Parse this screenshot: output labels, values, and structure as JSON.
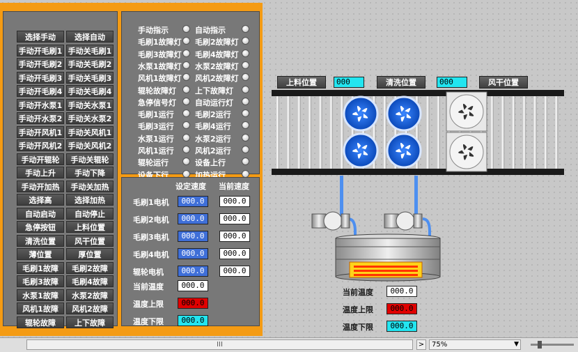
{
  "manual_buttons": [
    [
      "选择手动",
      "选择自动"
    ],
    [
      "手动开毛刷1",
      "手动关毛刷1"
    ],
    [
      "手动开毛刷2",
      "手动关毛刷2"
    ],
    [
      "手动开毛刷3",
      "手动关毛刷3"
    ],
    [
      "手动开毛刷4",
      "手动关毛刷4"
    ],
    [
      "手动开水泵1",
      "手动关水泵1"
    ],
    [
      "手动开水泵2",
      "手动关水泵2"
    ],
    [
      "手动开风机1",
      "手动关风机1"
    ],
    [
      "手动开风机2",
      "手动关风机2"
    ],
    [
      "手动开辊轮",
      "手动关辊轮"
    ],
    [
      "手动上升",
      "手动下降"
    ],
    [
      "手动开加热",
      "手动关加热"
    ],
    [
      "选择高",
      "选择加热"
    ],
    [
      "自动启动",
      "自动停止"
    ],
    [
      "急停按钮",
      "上料位置"
    ],
    [
      "清洗位置",
      "风干位置"
    ],
    [
      "薄位置",
      "厚位置"
    ],
    [
      "毛刷1故障",
      "毛刷2故障"
    ],
    [
      "毛刷3故障",
      "毛刷4故障"
    ],
    [
      "水泵1故障",
      "水泵2故障"
    ],
    [
      "风机1故障",
      "风机2故障"
    ],
    [
      "辊轮故障",
      "上下故障"
    ]
  ],
  "indicators": [
    [
      "手动指示",
      "自动指示"
    ],
    [
      "毛刷1故障灯",
      "毛刷2故障灯"
    ],
    [
      "毛刷3故障灯",
      "毛刷4故障灯"
    ],
    [
      "水泵1故障灯",
      "水泵2故障灯"
    ],
    [
      "风机1故障灯",
      "风机2故障灯"
    ],
    [
      "辊轮故障灯",
      "上下故障灯"
    ],
    [
      "急停信号灯",
      "自动运行灯"
    ],
    [
      "毛刷1运行",
      "毛刷2运行"
    ],
    [
      "毛刷3运行",
      "毛刷4运行"
    ],
    [
      "水泵1运行",
      "水泵2运行"
    ],
    [
      "风机1运行",
      "风机2运行"
    ],
    [
      "辊轮运行",
      "设备上行"
    ],
    [
      "设备下行",
      "加热运行"
    ]
  ],
  "speed": {
    "set_header": "设定速度",
    "cur_header": "当前速度",
    "rows": [
      {
        "label": "毛刷1电机",
        "set": "000.0",
        "cur": "000.0"
      },
      {
        "label": "毛刷2电机",
        "set": "000.0",
        "cur": "000.0"
      },
      {
        "label": "毛刷3电机",
        "set": "000.0",
        "cur": "000.0"
      },
      {
        "label": "毛刷4电机",
        "set": "000.0",
        "cur": "000.0"
      },
      {
        "label": "辊轮电机",
        "set": "000.0",
        "cur": "000.0"
      }
    ],
    "temp_rows": [
      {
        "label": "当前温度",
        "value": "000.0",
        "color": "#ffffff"
      },
      {
        "label": "温度上限",
        "value": "000.0",
        "color": "#e00000"
      },
      {
        "label": "温度下限",
        "value": "000.0",
        "color": "#22e5f0"
      }
    ]
  },
  "process": {
    "load_position_label": "上料位置",
    "load_value": "000",
    "wash_position_label": "清洗位置",
    "wash_value": "000",
    "dry_position_label": "风干位置",
    "temp_rows": [
      {
        "label": "当前温度",
        "value": "000.0",
        "color": "#ffffff"
      },
      {
        "label": "温度上限",
        "value": "000.0",
        "color": "#e00000"
      },
      {
        "label": "温度下限",
        "value": "000.0",
        "color": "#22e5f0"
      }
    ]
  },
  "statusbar": {
    "scroll_marker": "III",
    "nav_arrow": ">",
    "zoom": "75%"
  }
}
